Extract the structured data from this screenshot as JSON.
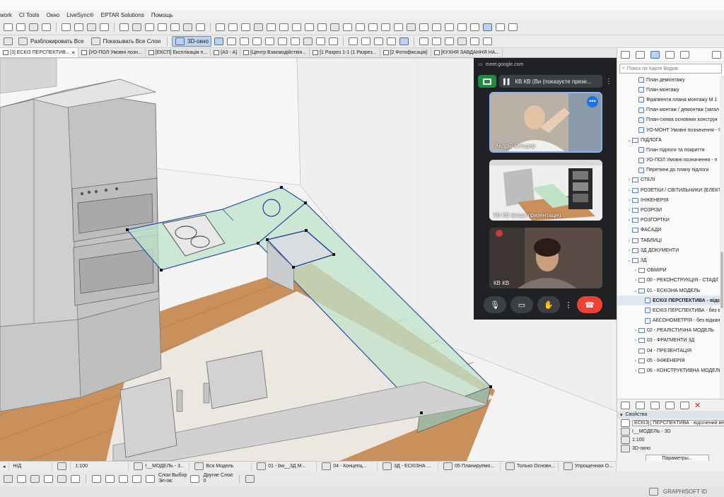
{
  "menu": [
    "work",
    "CI Tools",
    "Окно",
    "LiveSync®",
    "EPTAR Solutions",
    "Помощь"
  ],
  "toolbar2": {
    "unlock_all": "Разблокировать Все",
    "show_all_layers": "Показывать Все Слои",
    "window_3d": "3D-окно"
  },
  "tabs": [
    "[3] ЕСКІЗ ПЕРСПЕКТИВ...",
    "[УО-ПОЛ Умовні позн...",
    "[ЕКСП] Експлікація п...",
    "[A3 - A]",
    "[Центр Взаємодійствія...",
    "[1 Разрез 1-1 (1 Разрез...",
    "[2 Фотофіксація]",
    "[КУХНЯ ЗАВДАННЯ НА..."
  ],
  "meet": {
    "url": "meet.google.com",
    "presenter_label": "КВ КВ (Ви (показуєте презе...",
    "participants": [
      {
        "name": "Андрій Бліндер"
      },
      {
        "name": "КВ КВ (ваша презентація)"
      },
      {
        "name": "КВ КВ"
      }
    ]
  },
  "navigator": {
    "search_placeholder": "Поиск по Карте Видов",
    "items": [
      {
        "label": "План демонтажу",
        "depth": 2,
        "kind": "view"
      },
      {
        "label": "План монтажу",
        "depth": 2,
        "kind": "view"
      },
      {
        "label": "Фрагменти плана монтажу М 1",
        "depth": 2,
        "kind": "view"
      },
      {
        "label": "План монтаж / демонтаж (загал",
        "depth": 2,
        "kind": "view"
      },
      {
        "label": "План-схема основних конструк",
        "depth": 2,
        "kind": "view"
      },
      {
        "label": "УО-МОНТ Умовні позначення - б",
        "depth": 2,
        "kind": "view"
      },
      {
        "label": "ПІДЛОГА",
        "depth": 1,
        "kind": "folder",
        "arrow": "⌄"
      },
      {
        "label": "План підлоги та покриття",
        "depth": 2,
        "kind": "view"
      },
      {
        "label": "УО-ПОЛ Умовні позначення - п",
        "depth": 2,
        "kind": "view"
      },
      {
        "label": "Перетини до плану підлоги",
        "depth": 2,
        "kind": "view"
      },
      {
        "label": "СТЕЛІ",
        "depth": 1,
        "kind": "folder",
        "arrow": "›"
      },
      {
        "label": "РОЗЕТКИ / СВІТИЛЬНИКИ (ЕЛЕКТ",
        "depth": 1,
        "kind": "folder",
        "arrow": "›"
      },
      {
        "label": "ІНЖЕНЕРІЯ",
        "depth": 1,
        "kind": "folder",
        "arrow": "›"
      },
      {
        "label": "РОЗРІЗИ",
        "depth": 1,
        "kind": "folder",
        "arrow": "›"
      },
      {
        "label": "РОЗГОРТКИ",
        "depth": 1,
        "kind": "folder",
        "arrow": "›"
      },
      {
        "label": "ФАСАДИ",
        "depth": 1,
        "kind": "folder",
        "arrow": ""
      },
      {
        "label": "ТАБЛИЦІ",
        "depth": 1,
        "kind": "folder",
        "arrow": "›"
      },
      {
        "label": "3Д ДОКУМЕНТИ",
        "depth": 1,
        "kind": "folder",
        "arrow": "›"
      },
      {
        "label": "3Д",
        "depth": 1,
        "kind": "folder",
        "arrow": "⌄"
      },
      {
        "label": "ОБМІРИ",
        "depth": 2,
        "kind": "folder",
        "arrow": "›"
      },
      {
        "label": "00 - РЕКОНСТРУКЦІЯ - СТАДІЇ",
        "depth": 2,
        "kind": "folder",
        "arrow": "›"
      },
      {
        "label": "01 - ЕСКІЗНА МОДЕЛЬ",
        "depth": 2,
        "kind": "folder",
        "arrow": "⌄"
      },
      {
        "label": "ЕСКІЗ ПЕРСПЕКТИВА - відсі",
        "depth": 3,
        "kind": "view",
        "selected": true
      },
      {
        "label": "ЕСКІЗ ПЕРСПЕКТИВА - без від",
        "depth": 3,
        "kind": "view"
      },
      {
        "label": "АКСОНОМЕТРІЯ - без відкан",
        "depth": 3,
        "kind": "view"
      },
      {
        "label": "02 - РЕАЛІСТИЧНА МОДЕЛЬ",
        "depth": 2,
        "kind": "folder",
        "arrow": "›"
      },
      {
        "label": "03 - ФРАГМЕНТИ 3Д",
        "depth": 2,
        "kind": "folder",
        "arrow": "›"
      },
      {
        "label": "04 - ПРЕЗЕНТАЦІЯ",
        "depth": 2,
        "kind": "folder",
        "arrow": ""
      },
      {
        "label": "05 - ІНЖЕНЕРІЯ",
        "depth": 2,
        "kind": "folder",
        "arrow": "›"
      },
      {
        "label": "06 - КОНСТРУКТИВНА МОДЕЛЬ",
        "depth": 2,
        "kind": "folder",
        "arrow": "›"
      }
    ]
  },
  "properties": {
    "header": "Свойства",
    "id_value": "ЕСКІЗ",
    "name_value": "ПЕРСПЕКТИВА - відсічений верх",
    "layer_combo": "I__МОДЕЛЬ - 3D",
    "scale": "1:100",
    "window_type": "3D-окно",
    "params_button": "Параметры..."
  },
  "statusbar": {
    "nd": "Н/Д",
    "scale": "1:100",
    "layer_combo": "I__МОДЕЛЬ - 3...",
    "model": "Вся Модель",
    "pen_set": "01 - bw__3Д М...",
    "model_view": "04 - Концепц...",
    "graphic_override": "3Д - ЕСКІЗНА ...",
    "renovation": "05 Планируемо...",
    "structure": "Только Основн...",
    "dim": "Упрощенная О..."
  },
  "bottom_toolbar": {
    "layers_label_1": "Слои Выбор",
    "layers_label_2": "Эл-ов:",
    "other_layers_1": "Другие Слои:",
    "other_layers_2": "0"
  },
  "footer": {
    "brand": "GRAPHISOFT ID"
  }
}
